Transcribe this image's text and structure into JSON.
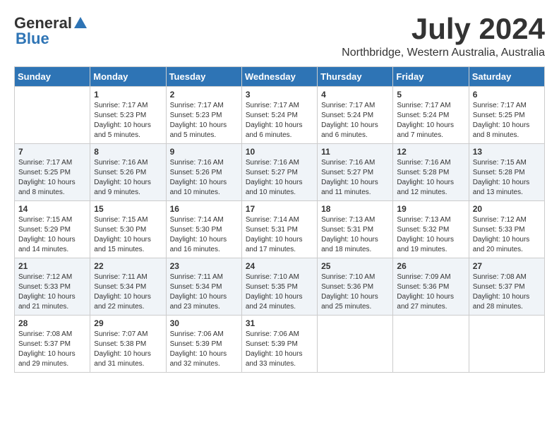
{
  "logo": {
    "general": "General",
    "blue": "Blue"
  },
  "header": {
    "month": "July 2024",
    "location": "Northbridge, Western Australia, Australia"
  },
  "days_of_week": [
    "Sunday",
    "Monday",
    "Tuesday",
    "Wednesday",
    "Thursday",
    "Friday",
    "Saturday"
  ],
  "weeks": [
    [
      {
        "day": "",
        "info": ""
      },
      {
        "day": "1",
        "info": "Sunrise: 7:17 AM\nSunset: 5:23 PM\nDaylight: 10 hours\nand 5 minutes."
      },
      {
        "day": "2",
        "info": "Sunrise: 7:17 AM\nSunset: 5:23 PM\nDaylight: 10 hours\nand 5 minutes."
      },
      {
        "day": "3",
        "info": "Sunrise: 7:17 AM\nSunset: 5:24 PM\nDaylight: 10 hours\nand 6 minutes."
      },
      {
        "day": "4",
        "info": "Sunrise: 7:17 AM\nSunset: 5:24 PM\nDaylight: 10 hours\nand 6 minutes."
      },
      {
        "day": "5",
        "info": "Sunrise: 7:17 AM\nSunset: 5:24 PM\nDaylight: 10 hours\nand 7 minutes."
      },
      {
        "day": "6",
        "info": "Sunrise: 7:17 AM\nSunset: 5:25 PM\nDaylight: 10 hours\nand 8 minutes."
      }
    ],
    [
      {
        "day": "7",
        "info": "Sunrise: 7:17 AM\nSunset: 5:25 PM\nDaylight: 10 hours\nand 8 minutes."
      },
      {
        "day": "8",
        "info": "Sunrise: 7:16 AM\nSunset: 5:26 PM\nDaylight: 10 hours\nand 9 minutes."
      },
      {
        "day": "9",
        "info": "Sunrise: 7:16 AM\nSunset: 5:26 PM\nDaylight: 10 hours\nand 10 minutes."
      },
      {
        "day": "10",
        "info": "Sunrise: 7:16 AM\nSunset: 5:27 PM\nDaylight: 10 hours\nand 10 minutes."
      },
      {
        "day": "11",
        "info": "Sunrise: 7:16 AM\nSunset: 5:27 PM\nDaylight: 10 hours\nand 11 minutes."
      },
      {
        "day": "12",
        "info": "Sunrise: 7:16 AM\nSunset: 5:28 PM\nDaylight: 10 hours\nand 12 minutes."
      },
      {
        "day": "13",
        "info": "Sunrise: 7:15 AM\nSunset: 5:28 PM\nDaylight: 10 hours\nand 13 minutes."
      }
    ],
    [
      {
        "day": "14",
        "info": "Sunrise: 7:15 AM\nSunset: 5:29 PM\nDaylight: 10 hours\nand 14 minutes."
      },
      {
        "day": "15",
        "info": "Sunrise: 7:15 AM\nSunset: 5:30 PM\nDaylight: 10 hours\nand 15 minutes."
      },
      {
        "day": "16",
        "info": "Sunrise: 7:14 AM\nSunset: 5:30 PM\nDaylight: 10 hours\nand 16 minutes."
      },
      {
        "day": "17",
        "info": "Sunrise: 7:14 AM\nSunset: 5:31 PM\nDaylight: 10 hours\nand 17 minutes."
      },
      {
        "day": "18",
        "info": "Sunrise: 7:13 AM\nSunset: 5:31 PM\nDaylight: 10 hours\nand 18 minutes."
      },
      {
        "day": "19",
        "info": "Sunrise: 7:13 AM\nSunset: 5:32 PM\nDaylight: 10 hours\nand 19 minutes."
      },
      {
        "day": "20",
        "info": "Sunrise: 7:12 AM\nSunset: 5:33 PM\nDaylight: 10 hours\nand 20 minutes."
      }
    ],
    [
      {
        "day": "21",
        "info": "Sunrise: 7:12 AM\nSunset: 5:33 PM\nDaylight: 10 hours\nand 21 minutes."
      },
      {
        "day": "22",
        "info": "Sunrise: 7:11 AM\nSunset: 5:34 PM\nDaylight: 10 hours\nand 22 minutes."
      },
      {
        "day": "23",
        "info": "Sunrise: 7:11 AM\nSunset: 5:34 PM\nDaylight: 10 hours\nand 23 minutes."
      },
      {
        "day": "24",
        "info": "Sunrise: 7:10 AM\nSunset: 5:35 PM\nDaylight: 10 hours\nand 24 minutes."
      },
      {
        "day": "25",
        "info": "Sunrise: 7:10 AM\nSunset: 5:36 PM\nDaylight: 10 hours\nand 25 minutes."
      },
      {
        "day": "26",
        "info": "Sunrise: 7:09 AM\nSunset: 5:36 PM\nDaylight: 10 hours\nand 27 minutes."
      },
      {
        "day": "27",
        "info": "Sunrise: 7:08 AM\nSunset: 5:37 PM\nDaylight: 10 hours\nand 28 minutes."
      }
    ],
    [
      {
        "day": "28",
        "info": "Sunrise: 7:08 AM\nSunset: 5:37 PM\nDaylight: 10 hours\nand 29 minutes."
      },
      {
        "day": "29",
        "info": "Sunrise: 7:07 AM\nSunset: 5:38 PM\nDaylight: 10 hours\nand 31 minutes."
      },
      {
        "day": "30",
        "info": "Sunrise: 7:06 AM\nSunset: 5:39 PM\nDaylight: 10 hours\nand 32 minutes."
      },
      {
        "day": "31",
        "info": "Sunrise: 7:06 AM\nSunset: 5:39 PM\nDaylight: 10 hours\nand 33 minutes."
      },
      {
        "day": "",
        "info": ""
      },
      {
        "day": "",
        "info": ""
      },
      {
        "day": "",
        "info": ""
      }
    ]
  ]
}
